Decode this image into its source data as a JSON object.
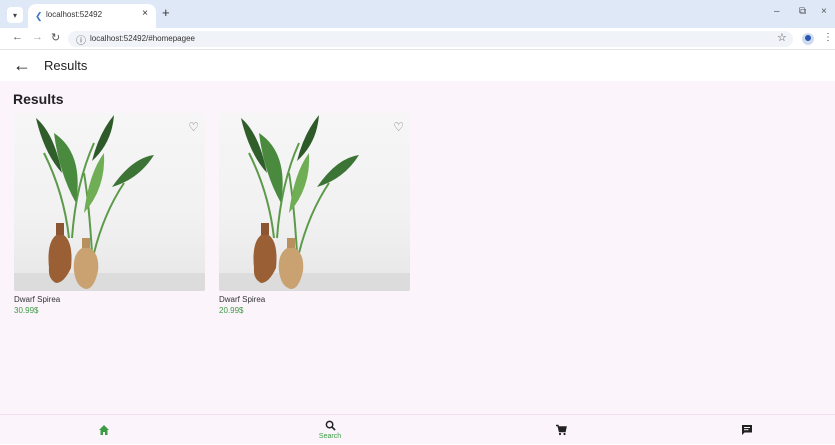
{
  "browser": {
    "tab_title": "localhost:52492",
    "tab_close": "×",
    "new_tab": "+",
    "url": "localhost:52492/#homepagee",
    "window_controls": {
      "minimize": "–",
      "restore": "⧉",
      "close": "×"
    }
  },
  "appbar": {
    "title": "Results",
    "back_icon": "arrow-left-icon"
  },
  "main": {
    "section_title": "Results",
    "products": [
      {
        "name": "Dwarf Spirea",
        "price": "30.99$",
        "favorite_icon": "heart-outline-icon"
      },
      {
        "name": "Dwarf Spirea",
        "price": "20.99$",
        "favorite_icon": "heart-outline-icon"
      }
    ]
  },
  "bottom_nav": {
    "items": [
      {
        "icon": "home-icon",
        "label": "",
        "active": true
      },
      {
        "icon": "search-icon",
        "label": "Search",
        "active": false
      },
      {
        "icon": "cart-icon",
        "label": "",
        "active": false
      },
      {
        "icon": "chat-icon",
        "label": "",
        "active": false
      }
    ]
  },
  "colors": {
    "accent": "#3d9a45",
    "background": "#fbf4fb",
    "chrome": "#dfe8f7"
  }
}
